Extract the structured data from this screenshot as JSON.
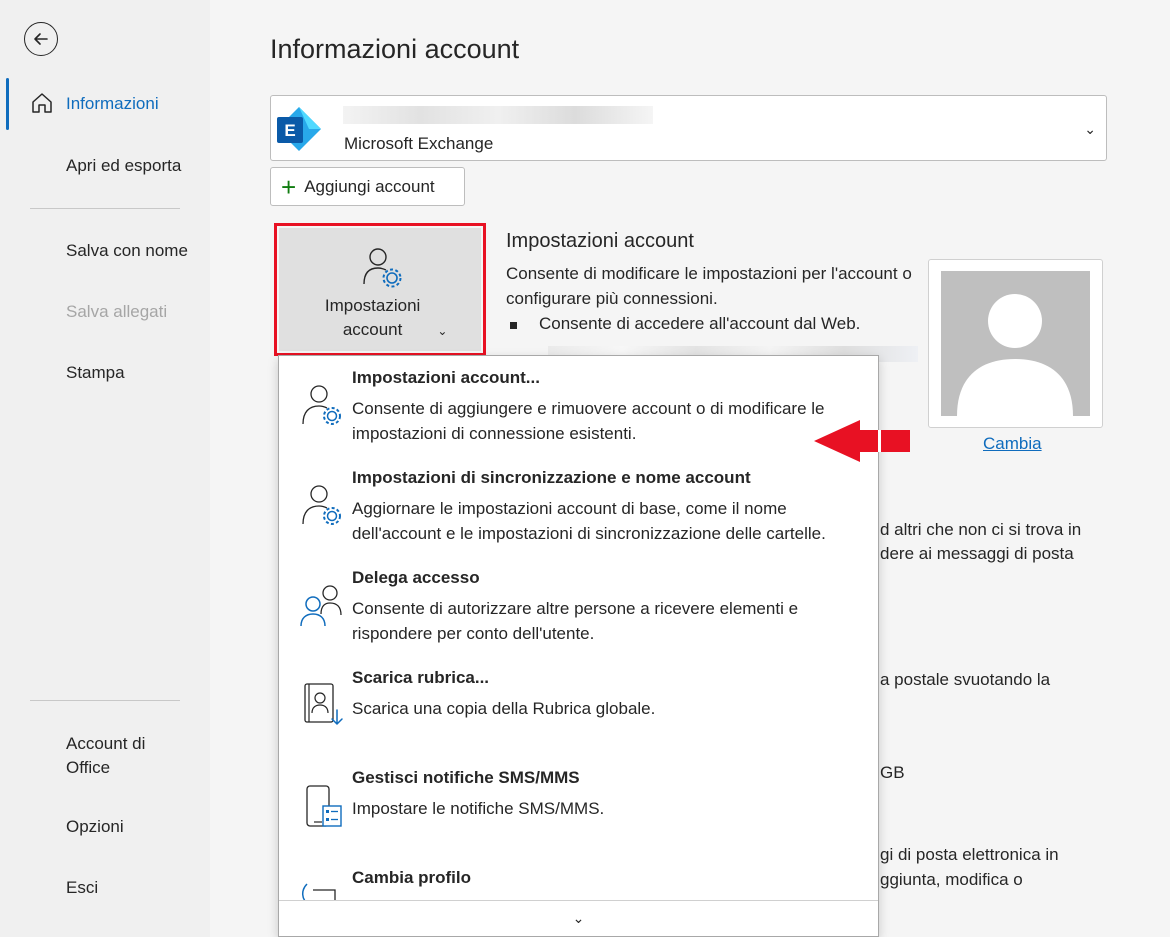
{
  "sidebar": {
    "items": [
      {
        "label": "Informazioni"
      },
      {
        "label": "Apri ed esporta"
      },
      {
        "label": "Salva con nome"
      },
      {
        "label": "Salva allegati"
      },
      {
        "label": "Stampa"
      },
      {
        "label": "Account di Office"
      },
      {
        "label": "Opzioni"
      },
      {
        "label": "Esci"
      }
    ]
  },
  "main": {
    "title": "Informazioni account",
    "account_type": "Microsoft Exchange",
    "add_account_label": "Aggiungi account",
    "settings_button_label": "Impostazioni account",
    "section_title": "Impostazioni account",
    "section_desc": "Consente di modificare le impostazioni per l'account o configurare più connessioni.",
    "bullet": "Consente di accedere all'account dal Web.",
    "change_link": "Cambia",
    "bg_fragments": [
      "d altri che non ci si trova in",
      "dere ai messaggi di posta",
      "a postale svuotando la",
      "GB",
      "gi di posta elettronica in",
      "ggiunta, modifica o"
    ]
  },
  "dropdown": {
    "items": [
      {
        "title": "Impostazioni account...",
        "desc": "Consente di aggiungere e rimuovere account o di modificare le impostazioni di connessione esistenti.",
        "icon": "account-settings-icon"
      },
      {
        "title": "Impostazioni di sincronizzazione e nome account",
        "desc": "Aggiornare le impostazioni account di base, come il nome dell'account e le impostazioni di sincronizzazione delle cartelle.",
        "icon": "sync-settings-icon"
      },
      {
        "title": "Delega accesso",
        "desc": "Consente di autorizzare altre persone a ricevere elementi e rispondere per conto dell'utente.",
        "icon": "delegate-icon"
      },
      {
        "title": "Scarica rubrica...",
        "desc": "Scarica una copia della Rubrica globale.",
        "icon": "address-book-download-icon"
      },
      {
        "title": "Gestisci notifiche SMS/MMS",
        "desc": "Impostare le notifiche SMS/MMS.",
        "icon": "mobile-notifications-icon"
      },
      {
        "title": "Cambia profilo",
        "desc": "",
        "icon": "change-profile-icon"
      }
    ]
  },
  "colors": {
    "accent": "#0f6cbd",
    "highlight_border": "#e81123",
    "arrow": "#e81123"
  }
}
